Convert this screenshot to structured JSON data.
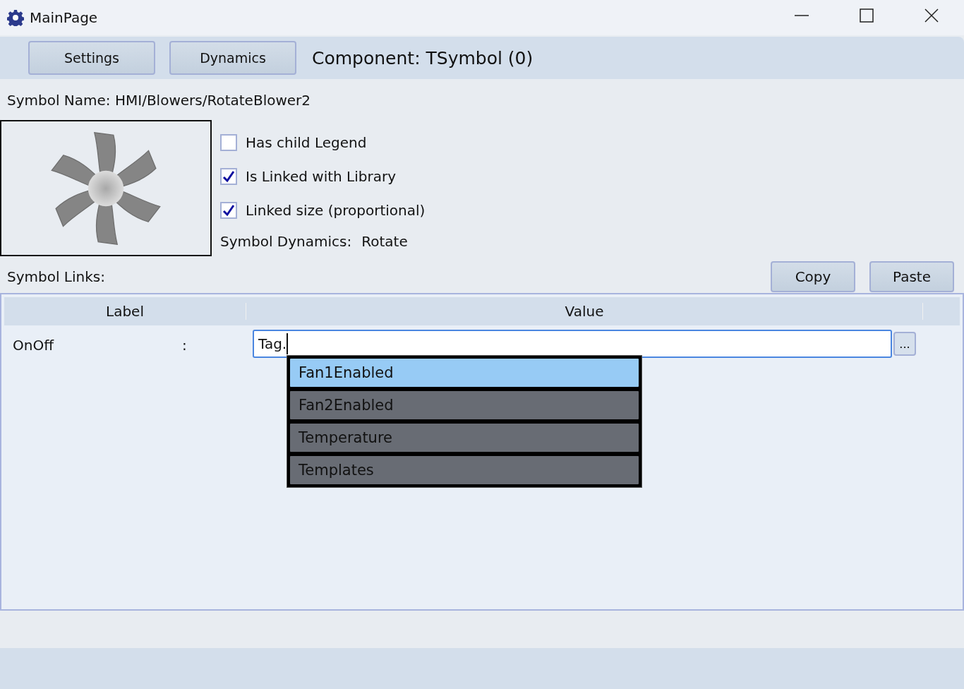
{
  "window": {
    "title": "MainPage"
  },
  "toolbar": {
    "buttons": [
      "Settings",
      "Dynamics"
    ],
    "component": "Component: TSymbol (0)"
  },
  "symbol_name": "Symbol Name: HMI/Blowers/RotateBlower2",
  "options": [
    {
      "label": "Has child Legend",
      "checked": false
    },
    {
      "label": "Is Linked with Library",
      "checked": true
    },
    {
      "label": "Linked size (proportional)",
      "checked": true
    }
  ],
  "dynamics": {
    "label": "Symbol Dynamics:",
    "value": "Rotate"
  },
  "links": {
    "title": "Symbol Links:",
    "buttons": [
      "Copy",
      "Paste"
    ],
    "columns": [
      "Label",
      "Value"
    ],
    "rows": [
      {
        "label": "OnOff",
        "separator": ":",
        "value": "Tag.",
        "browse": "..."
      }
    ],
    "suggestions": [
      {
        "text": "Fan1Enabled",
        "selected": true
      },
      {
        "text": "Fan2Enabled",
        "selected": false
      },
      {
        "text": "Temperature",
        "selected": false
      },
      {
        "text": "Templates",
        "selected": false
      }
    ]
  }
}
